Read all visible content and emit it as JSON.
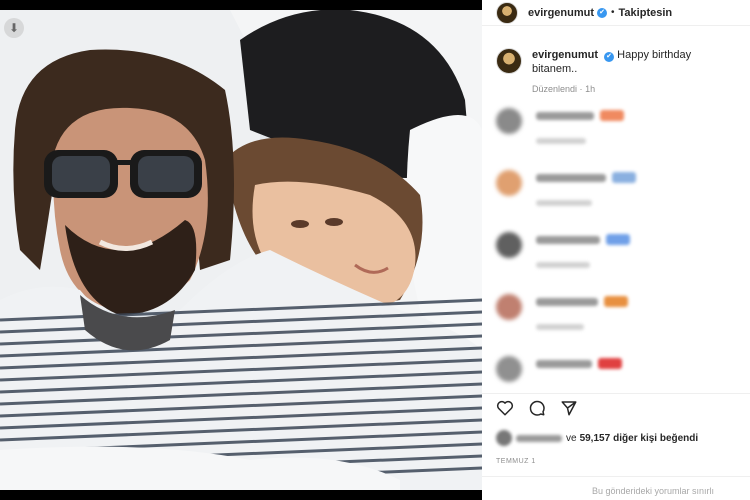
{
  "post": {
    "username": "evirgenumut",
    "follow_status": "Takiptesin",
    "caption_text": "Happy birthday bitanem..",
    "edited_label": "Düzenlendi",
    "edited_time": "1h",
    "likes_connector": "ve",
    "likes_count": "59,157",
    "likes_suffix": "diğer kişi beğendi",
    "date": "TEMMUZ 1",
    "comments_restricted": "Bu gönderideki yorumlar sınırlı"
  },
  "icons": {
    "download": "download-icon",
    "verified": "verified-badge-icon",
    "like": "heart-icon",
    "comment": "comment-bubble-icon",
    "share": "paper-plane-icon"
  },
  "colors": {
    "verified": "#3897f0",
    "text": "#262626",
    "muted": "#8e8e8e"
  },
  "blurred_comments": [
    {
      "avatar": "#8a8a8a",
      "line1": 58,
      "emoji_color": "#f08a60",
      "line2": 50
    },
    {
      "avatar": "#e0a070",
      "line1": 70,
      "emoji_color": "#8ab0e0",
      "line2": 56
    },
    {
      "avatar": "#606060",
      "line1": 64,
      "emoji_color": "#70a0e8",
      "line2": 54
    },
    {
      "avatar": "#c08070",
      "line1": 62,
      "emoji_color": "#e89040",
      "line2": 48
    },
    {
      "avatar": "#909090",
      "line1": 56,
      "emoji_color": "#e04040",
      "line2": 0
    }
  ]
}
